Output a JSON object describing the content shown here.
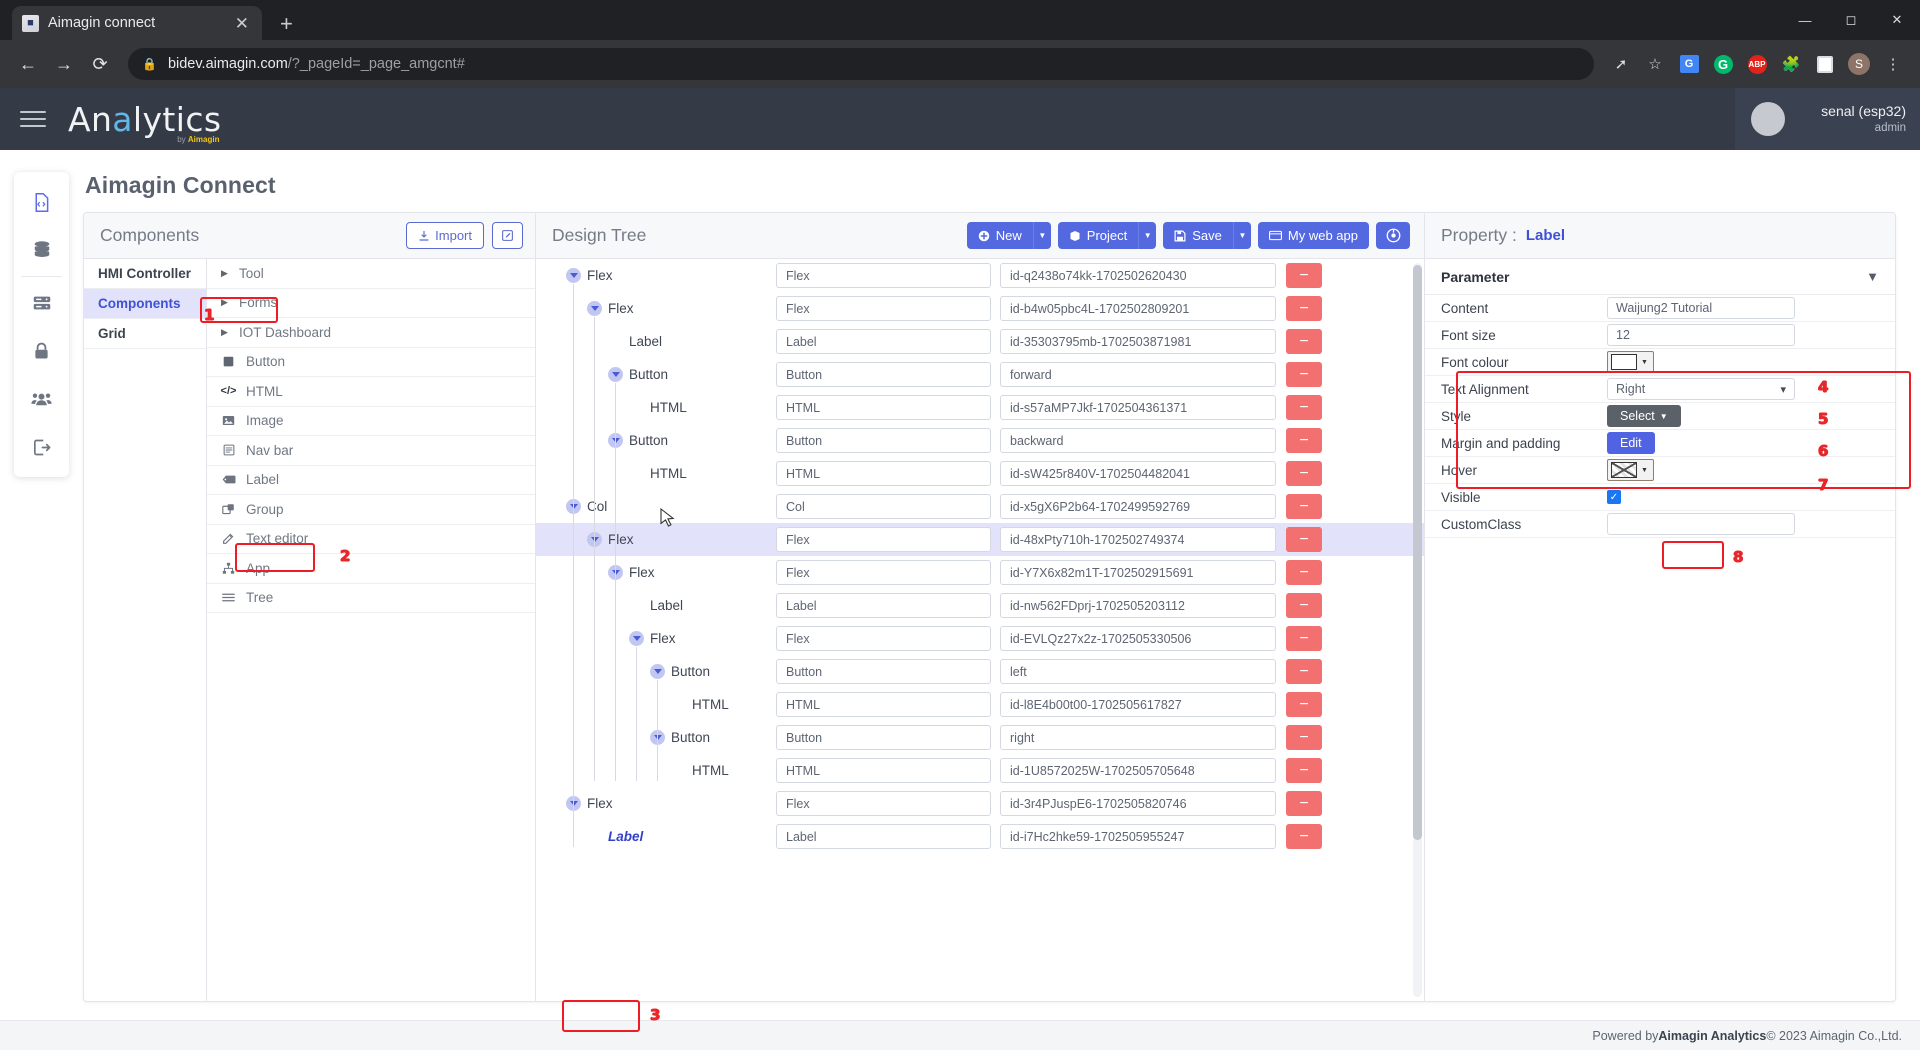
{
  "browser": {
    "tab": {
      "title": "Aimagin connect",
      "favicon_icon": "app-favicon",
      "close_icon": "close-icon"
    },
    "new_tab_icon": "plus-icon",
    "nav": {
      "back_icon": "back-arrow-icon",
      "forward_icon": "forward-arrow-icon",
      "reload_icon": "reload-icon"
    },
    "omnibox": {
      "lock_icon": "lock-icon",
      "host": "bidev.aimagin.com",
      "path": "/?_pageId=_page_amgcnt#"
    },
    "toolbar_icons": [
      "share-icon",
      "bookmark-star-icon",
      "google-translate-icon",
      "grammarly-icon",
      "adblock-plus-icon",
      "extensions-puzzle-icon",
      "reading-list-icon",
      "profile-avatar-icon",
      "chrome-menu-icon"
    ],
    "profile_initial": "S",
    "window_controls": [
      "minimize-icon",
      "restore-icon",
      "close-icon"
    ]
  },
  "appbar": {
    "menu_icon": "hamburger-menu-icon",
    "brand_prefix": "An",
    "brand_highlight": "a",
    "brand_suffix": "lytics",
    "brand_sub_by": "by",
    "brand_sub_name": "Aimagin",
    "user_name": "senal (esp32)",
    "user_role": "admin"
  },
  "rail": {
    "items": [
      {
        "name": "sidebar-item-code",
        "icon": "file-code-icon"
      },
      {
        "name": "sidebar-item-database",
        "icon": "database-icon"
      },
      {
        "name": "sidebar-item-server",
        "icon": "server-icon"
      },
      {
        "name": "sidebar-item-security",
        "icon": "lock-icon"
      },
      {
        "name": "sidebar-item-users",
        "icon": "users-icon"
      },
      {
        "name": "sidebar-item-logout",
        "icon": "logout-icon"
      }
    ]
  },
  "page": {
    "title": "Aimagin Connect"
  },
  "components": {
    "header": "Components",
    "import_label": "Import",
    "import_icon": "download-icon",
    "edit_icon": "pencil-square-icon",
    "categories": [
      {
        "label": "HMI Controller",
        "active": false
      },
      {
        "label": "Components",
        "active": true
      },
      {
        "label": "Grid",
        "active": false
      }
    ],
    "groups": [
      {
        "label": "Tool",
        "icon": "caret-right-icon"
      },
      {
        "label": "Forms",
        "icon": "caret-right-icon"
      },
      {
        "label": "IOT Dashboard",
        "icon": "caret-right-icon"
      }
    ],
    "items": [
      {
        "label": "Button",
        "icon": "square-solid-icon"
      },
      {
        "label": "HTML",
        "icon": "code-brackets-icon"
      },
      {
        "label": "Image",
        "icon": "image-icon"
      },
      {
        "label": "Nav bar",
        "icon": "navbar-icon"
      },
      {
        "label": "Label",
        "icon": "tag-icon"
      },
      {
        "label": "Group",
        "icon": "layers-icon"
      },
      {
        "label": "Text editor",
        "icon": "pencil-square-icon"
      },
      {
        "label": "App",
        "icon": "sitemap-icon"
      },
      {
        "label": "Tree",
        "icon": "list-tree-icon"
      }
    ]
  },
  "design_tree": {
    "header": "Design Tree",
    "toolbar": {
      "new_label": "New",
      "new_icon": "plus-circle-icon",
      "project_label": "Project",
      "project_icon": "box-icon",
      "save_label": "Save",
      "save_icon": "floppy-disk-icon",
      "mywebapp_label": "My web app",
      "mywebapp_icon": "window-icon",
      "preview_icon": "eye-icon",
      "caret_icon": "caret-down-icon"
    },
    "rows": [
      {
        "name": "Flex",
        "depth": 1,
        "caret": true,
        "type": "Flex",
        "id": "id-q2438o74kk-1702502620430",
        "selected": false
      },
      {
        "name": "Flex",
        "depth": 2,
        "caret": true,
        "type": "Flex",
        "id": "id-b4w05pbc4L-1702502809201",
        "selected": false
      },
      {
        "name": "Label",
        "depth": 3,
        "caret": false,
        "type": "Label",
        "id": "id-35303795mb-1702503871981",
        "selected": false
      },
      {
        "name": "Button",
        "depth": 3,
        "caret": true,
        "type": "Button",
        "id": "forward",
        "selected": false
      },
      {
        "name": "HTML",
        "depth": 4,
        "caret": false,
        "type": "HTML",
        "id": "id-s57aMP7Jkf-1702504361371",
        "selected": false
      },
      {
        "name": "Button",
        "depth": 3,
        "caret": true,
        "type": "Button",
        "id": "backward",
        "selected": false
      },
      {
        "name": "HTML",
        "depth": 4,
        "caret": false,
        "type": "HTML",
        "id": "id-sW425r840V-1702504482041",
        "selected": false
      },
      {
        "name": "Col",
        "depth": 1,
        "caret": true,
        "type": "Col",
        "id": "id-x5gX6P2b64-1702499592769",
        "selected": false
      },
      {
        "name": "Flex",
        "depth": 2,
        "caret": true,
        "type": "Flex",
        "id": "id-48xPty710h-1702502749374",
        "selected": true
      },
      {
        "name": "Flex",
        "depth": 3,
        "caret": true,
        "type": "Flex",
        "id": "id-Y7X6x82m1T-1702502915691",
        "selected": false
      },
      {
        "name": "Label",
        "depth": 4,
        "caret": false,
        "type": "Label",
        "id": "id-nw562FDprj-1702505203112",
        "selected": false
      },
      {
        "name": "Flex",
        "depth": 4,
        "caret": true,
        "type": "Flex",
        "id": "id-EVLQz27x2z-1702505330506",
        "selected": false
      },
      {
        "name": "Button",
        "depth": 5,
        "caret": true,
        "type": "Button",
        "id": "left",
        "selected": false
      },
      {
        "name": "HTML",
        "depth": 6,
        "caret": false,
        "type": "HTML",
        "id": "id-l8E4b00t00-1702505617827",
        "selected": false
      },
      {
        "name": "Button",
        "depth": 5,
        "caret": true,
        "type": "Button",
        "id": "right",
        "selected": false
      },
      {
        "name": "HTML",
        "depth": 6,
        "caret": false,
        "type": "HTML",
        "id": "id-1U8572025W-1702505705648",
        "selected": false
      },
      {
        "name": "Flex",
        "depth": 1,
        "caret": true,
        "type": "Flex",
        "id": "id-3r4PJuspE6-1702505820746",
        "selected": false
      },
      {
        "name": "Label",
        "depth": 2,
        "caret": false,
        "type": "Label",
        "id": "id-i7Hc2hke59-1702505955247",
        "selected": false,
        "highlight": true
      }
    ],
    "remove_icon": "minus-icon"
  },
  "property": {
    "header_label": "Property :",
    "header_value": "Label",
    "section_title": "Parameter",
    "collapse_icon": "chevron-down-icon",
    "fields": [
      {
        "key": "Content",
        "type": "input",
        "value": "Waijung2 Tutorial",
        "name": "content-field"
      },
      {
        "key": "Font size",
        "type": "input",
        "value": "12",
        "name": "font-size-field"
      },
      {
        "key": "Font colour",
        "type": "color",
        "value": "#ffffff",
        "name": "font-colour-picker"
      },
      {
        "key": "Text Alignment",
        "type": "select",
        "value": "Right",
        "name": "text-alignment-select"
      },
      {
        "key": "Style",
        "type": "button-gray",
        "value": "Select",
        "name": "style-select-button"
      },
      {
        "key": "Margin and padding",
        "type": "button-blue",
        "value": "Edit",
        "name": "margin-padding-edit-button"
      },
      {
        "key": "Hover",
        "type": "color-hatch",
        "value": "",
        "name": "hover-colour-picker"
      },
      {
        "key": "Visible",
        "type": "checkbox",
        "value": "checked",
        "name": "visible-checkbox"
      },
      {
        "key": "CustomClass",
        "type": "input",
        "value": "",
        "name": "customclass-field"
      }
    ]
  },
  "annotations": {
    "badges": [
      "1",
      "2",
      "3",
      "4",
      "5",
      "6",
      "7",
      "8"
    ]
  },
  "footer": {
    "prefix": "Powered by ",
    "brand": "Aimagin Analytics",
    "suffix": " © 2023 Aimagin Co.,Ltd."
  },
  "colors": {
    "accent_blue": "#5468e0",
    "link_blue": "#3f51d4",
    "danger_red": "#f2706f",
    "annotation_red": "#ee1c25",
    "appbar_bg": "#343a46"
  }
}
